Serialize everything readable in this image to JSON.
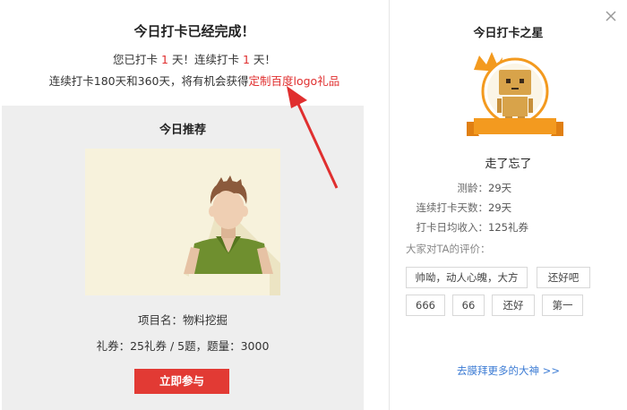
{
  "main": {
    "title": "今日打卡已经完成！",
    "line1_prefix": "您已打卡",
    "line1_count1": "1",
    "line1_mid": "天！连续打卡",
    "line1_count2": "1",
    "line1_suffix": "天！",
    "line2_text": "连续打卡180天和360天，将有机会获得",
    "line2_link": "定制百度logo礼品"
  },
  "recommend": {
    "title": "今日推荐",
    "project_name": "项目名：物料挖掘",
    "project_info": "礼券：25礼券 / 5题，题量：3000",
    "join_label": "立即参与"
  },
  "star": {
    "title": "今日打卡之星",
    "username": "走了忘了",
    "stats": [
      {
        "label": "测龄：",
        "value": "29天"
      },
      {
        "label": "连续打卡天数：",
        "value": "29天"
      },
      {
        "label": "打卡日均收入：",
        "value": "125礼券"
      }
    ],
    "eval_title": "大家对TA的评价：",
    "tags_row1": [
      "帅呦，动人心魄，大方",
      "还好吧"
    ],
    "tags_row2": [
      "666",
      "66",
      "还好",
      "第一"
    ],
    "more_link": "去膜拜更多的大神 >>"
  },
  "colors": {
    "accent_red": "#e23a34",
    "link_blue": "#3b7bd4",
    "badge_orange": "#f39a1f"
  },
  "icons": {
    "close": "close-icon",
    "arrow": "red-arrow-annotation",
    "badge": "crown-robot-badge-icon",
    "avatar": "male-avatar-illustration"
  }
}
